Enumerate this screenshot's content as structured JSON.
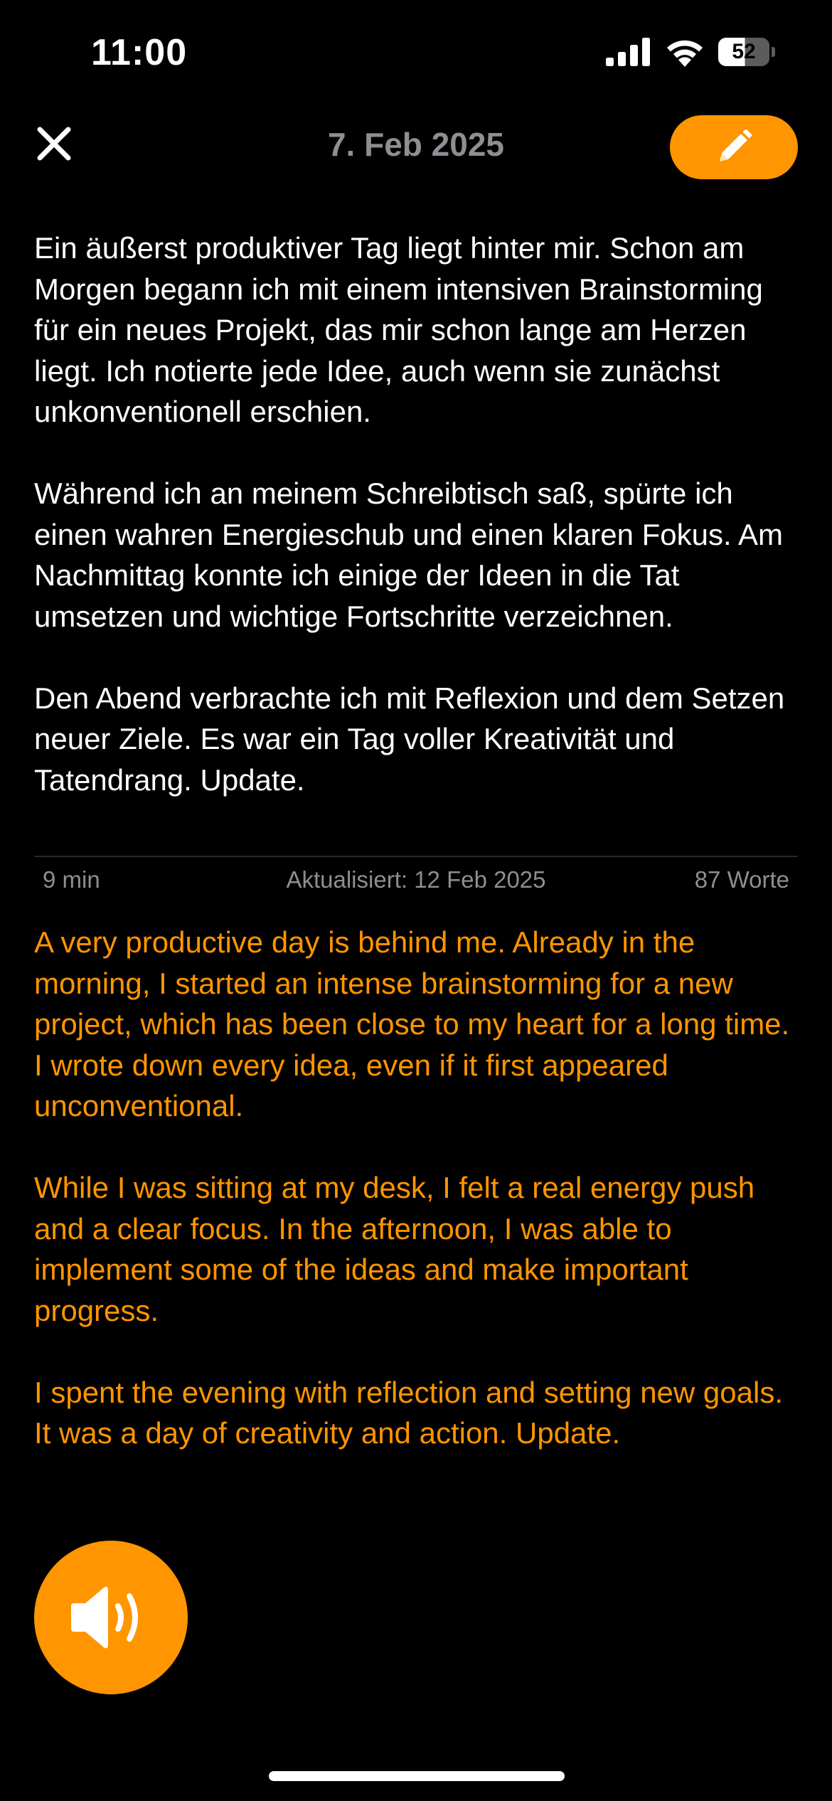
{
  "status_bar": {
    "time": "11:00",
    "battery": "52",
    "battery_level_percent": 52
  },
  "nav": {
    "title": "7. Feb 2025",
    "close_icon": "close-icon",
    "edit_icon": "pencil-icon"
  },
  "entry": {
    "paragraphs": [
      "Ein äußerst produktiver Tag liegt hinter mir. Schon am Morgen begann ich mit einem intensiven Brainstorming für ein neues Projekt, das mir schon lange am Herzen liegt. Ich notierte jede Idee, auch wenn sie zunächst unkonventionell erschien.",
      "Während ich an meinem Schreibtisch saß, spürte ich einen wahren Energieschub und einen klaren Fokus. Am Nachmittag konnte ich einige der Ideen in die Tat umsetzen und wichtige Fortschritte verzeichnen.",
      "Den Abend verbrachte ich mit Reflexion und dem Setzen neuer Ziele. Es war ein Tag voller Kreativität und Tatendrang. Update."
    ]
  },
  "meta": {
    "duration": "9 min",
    "updated": "Aktualisiert: 12 Feb 2025",
    "words": "87 Worte"
  },
  "translation": {
    "paragraphs": [
      "A very productive day is behind me. Already in the morning, I started an intense brainstorming for a new project, which has been close to my heart for a long time. I wrote down every idea, even if it first appeared unconventional.",
      "While I was sitting at my desk, I felt a real energy push and a clear focus. In the afternoon, I was able to implement some of the ideas and make important progress.",
      "I spent the evening with reflection and setting new goals. It was a day of creativity and action. Update."
    ]
  },
  "speaker": {
    "icon": "speaker-icon"
  },
  "colors": {
    "accent": "#ff9500",
    "background": "#000000",
    "text": "#ffffff",
    "secondary": "#8e8e93"
  }
}
